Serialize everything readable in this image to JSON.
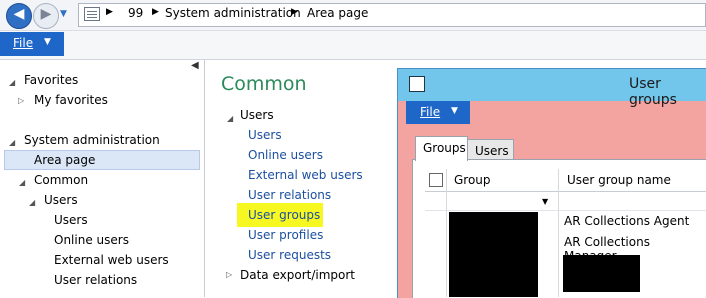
{
  "addressbar": {
    "company": "99",
    "breadcrumbs": [
      "System administration",
      "Area page"
    ]
  },
  "ribbon": {
    "file_label": "File"
  },
  "nav": {
    "favorites": "Favorites",
    "my_favorites": "My favorites",
    "system_admin": "System administration",
    "area_page": "Area page",
    "common": "Common",
    "users": "Users",
    "items": [
      "Users",
      "Online users",
      "External web users",
      "User relations"
    ]
  },
  "content": {
    "title": "Common",
    "users_group": "Users",
    "links": [
      "Users",
      "Online users",
      "External web users",
      "User relations",
      "User groups",
      "User profiles",
      "User requests"
    ],
    "data_export": "Data export/import"
  },
  "window": {
    "title": "User groups",
    "file_label": "File",
    "tabs": [
      "Groups",
      "Users"
    ],
    "columns": [
      "Group",
      "User group name"
    ],
    "rows": [
      {
        "name": "AR Collections Agent"
      },
      {
        "name": "AR Collections Manager"
      }
    ]
  },
  "colors": {
    "accent": "#1e67c9",
    "title_bar": "#72c6ec",
    "highlight": "#f7f722",
    "window_bg": "#f4a4a0"
  }
}
